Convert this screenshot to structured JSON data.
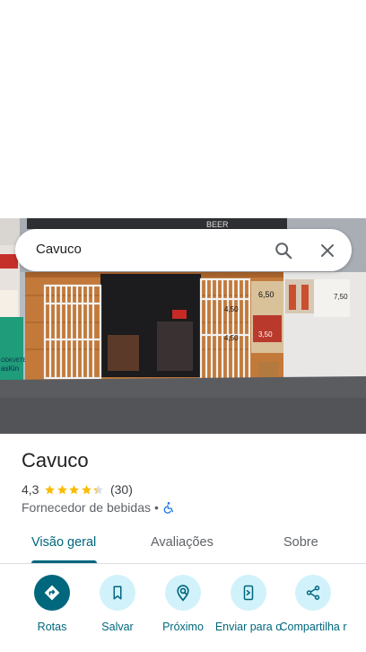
{
  "search": {
    "query": "Cavuco"
  },
  "place": {
    "name": "Cavuco",
    "rating": "4,3",
    "stars": 4.3,
    "review_count": "(30)",
    "category": "Fornecedor de bebidas",
    "separator": "•"
  },
  "photo": {
    "sign_text": "BEER",
    "price_tags": [
      "6,50",
      "4,50",
      "4,50",
      "3,50"
    ],
    "left_sign_text": "ODKVETES",
    "left_sign_text_2": "asKin",
    "fridge_label": "7,50"
  },
  "tabs": [
    {
      "label": "Visão geral",
      "active": true
    },
    {
      "label": "Avaliações",
      "active": false
    },
    {
      "label": "Sobre",
      "active": false
    }
  ],
  "actions": [
    {
      "label": "Rotas",
      "icon": "directions-icon"
    },
    {
      "label": "Salvar",
      "icon": "bookmark-icon"
    },
    {
      "label": "Próximo",
      "icon": "nearby-icon"
    },
    {
      "label": "Enviar para o",
      "icon": "send-to-phone-icon"
    },
    {
      "label": "Compartilha r",
      "icon": "share-icon"
    }
  ],
  "colors": {
    "accent": "#00677d",
    "action_bg": "#d2f2fb",
    "star": "#fbbc04",
    "accessibility": "#1a73e8"
  }
}
